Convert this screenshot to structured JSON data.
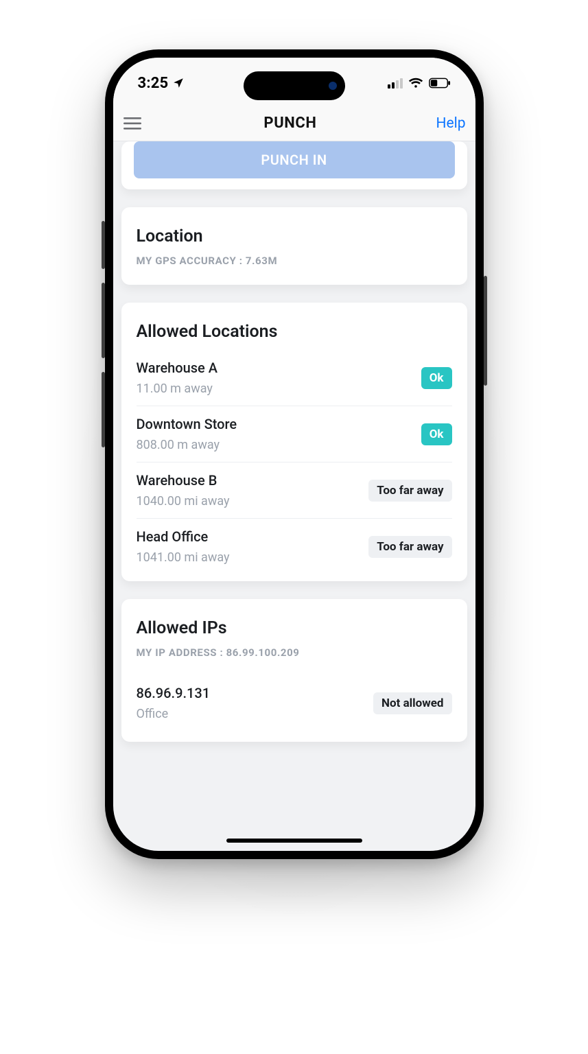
{
  "status_bar": {
    "time": "3:25"
  },
  "nav": {
    "title": "PUNCH",
    "help_label": "Help"
  },
  "punch": {
    "button_label": "PUNCH IN"
  },
  "location_card": {
    "title": "Location",
    "subtitle": "MY GPS ACCURACY : 7.63M"
  },
  "allowed_locations": {
    "title": "Allowed Locations",
    "items": [
      {
        "name": "Warehouse A",
        "distance": "11.00 m away",
        "status": "Ok",
        "status_kind": "ok"
      },
      {
        "name": "Downtown Store",
        "distance": "808.00 m away",
        "status": "Ok",
        "status_kind": "ok"
      },
      {
        "name": "Warehouse B",
        "distance": "1040.00 mi away",
        "status": "Too far away",
        "status_kind": "far"
      },
      {
        "name": "Head Office",
        "distance": "1041.00 mi away",
        "status": "Too far away",
        "status_kind": "far"
      }
    ]
  },
  "allowed_ips": {
    "title": "Allowed IPs",
    "subtitle": "MY IP ADDRESS : 86.99.100.209",
    "items": [
      {
        "ip": "86.96.9.131",
        "label": "Office",
        "status": "Not allowed",
        "status_kind": "notallowed"
      }
    ]
  }
}
